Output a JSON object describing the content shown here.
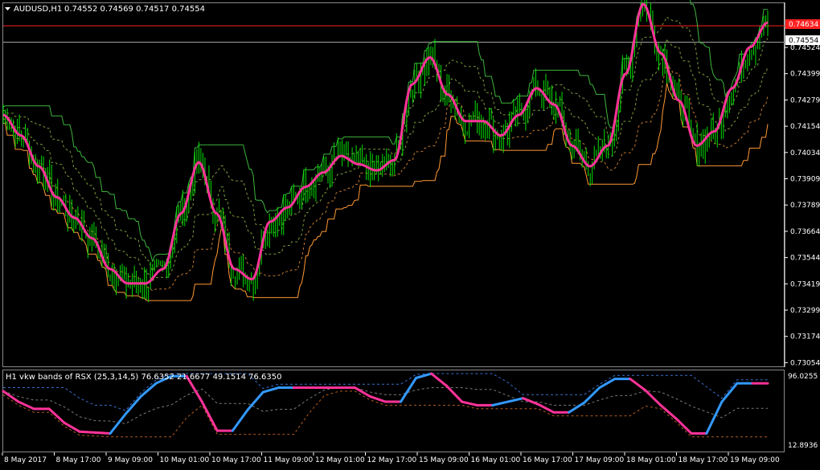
{
  "window": {
    "symbol_title": "AUDUSD,H1",
    "ohlc": "0.74552 0.74569 0.74517 0.74554",
    "subwindow_title": "H1 vkw bands of RSX (25,3,14,5) 76.6352 21.6677 49.1514 76.6350"
  },
  "main_axis": {
    "labels": [
      "0.74524",
      "0.74399",
      "0.74279",
      "0.74154",
      "0.74034",
      "0.73909",
      "0.73789",
      "0.73664",
      "0.73544",
      "0.73419",
      "0.73299",
      "0.73174",
      "0.73054"
    ],
    "price_tag_red": "0.74634",
    "price_tag_white": "0.74554"
  },
  "sub_axis": {
    "top_label": "96.0255",
    "bottom_label": "12.8936"
  },
  "time_axis": {
    "labels": [
      "8 May 2017",
      "8 May 17:00",
      "9 May 09:00",
      "10 May 01:00",
      "10 May 17:00",
      "11 May 09:00",
      "12 May 01:00",
      "12 May 17:00",
      "15 May 09:00",
      "16 May 01:00",
      "16 May 17:00",
      "17 May 09:00",
      "18 May 01:00",
      "18 May 17:00",
      "19 May 09:00"
    ]
  },
  "colors": {
    "background": "#000000",
    "candles": "#00e000",
    "smooth_line": "#ff3399",
    "band_solid": "#3cb43c",
    "band_dashed": "#7a9a3a",
    "lower_band": "#ff9933",
    "hline_red": "#ff2020",
    "hline_gray": "#a0a0a0",
    "rsx_up": "#3399ff",
    "rsx_down": "#ff3399",
    "axis_text": "#ffffff"
  },
  "chart_data": {
    "type": "line",
    "main_price_series": {
      "name": "AUDUSD,H1",
      "y_range": [
        0.7298,
        0.7474
      ],
      "x_labels": [
        "8 May 2017",
        "8 May 17:00",
        "9 May 09:00",
        "10 May 01:00",
        "10 May 17:00",
        "11 May 09:00",
        "12 May 01:00",
        "12 May 17:00",
        "15 May 09:00",
        "16 May 01:00",
        "16 May 17:00",
        "17 May 09:00",
        "18 May 01:00",
        "18 May 17:00",
        "19 May 09:00"
      ],
      "smooth_line": [
        0.742,
        0.741,
        0.7395,
        0.738,
        0.737,
        0.736,
        0.7345,
        0.7338,
        0.7338,
        0.7345,
        0.7372,
        0.7397,
        0.7372,
        0.7345,
        0.734,
        0.7368,
        0.7375,
        0.7385,
        0.7392,
        0.74,
        0.7396,
        0.7393,
        0.7398,
        0.7435,
        0.7448,
        0.743,
        0.7417,
        0.7417,
        0.741,
        0.742,
        0.7433,
        0.7425,
        0.7405,
        0.7395,
        0.7405,
        0.744,
        0.7474,
        0.745,
        0.7427,
        0.7405,
        0.7412,
        0.7433,
        0.7453,
        0.7465
      ],
      "horizontal_lines": [
        0.74634,
        0.74554
      ]
    },
    "rsx_series": {
      "name": "vkw bands of RSX",
      "y_range": [
        12.8936,
        96.0255
      ],
      "values": [
        76,
        64,
        56,
        56,
        40,
        30,
        29,
        28,
        50,
        70,
        85,
        93,
        93,
        64,
        31,
        31,
        55,
        75,
        80,
        80,
        80,
        80,
        80,
        80,
        70,
        64,
        64,
        91,
        96,
        82,
        64,
        60,
        60,
        64,
        68,
        61,
        52,
        52,
        63,
        80,
        90,
        90,
        77,
        60,
        45,
        28,
        28,
        64,
        85,
        85,
        85
      ]
    }
  }
}
